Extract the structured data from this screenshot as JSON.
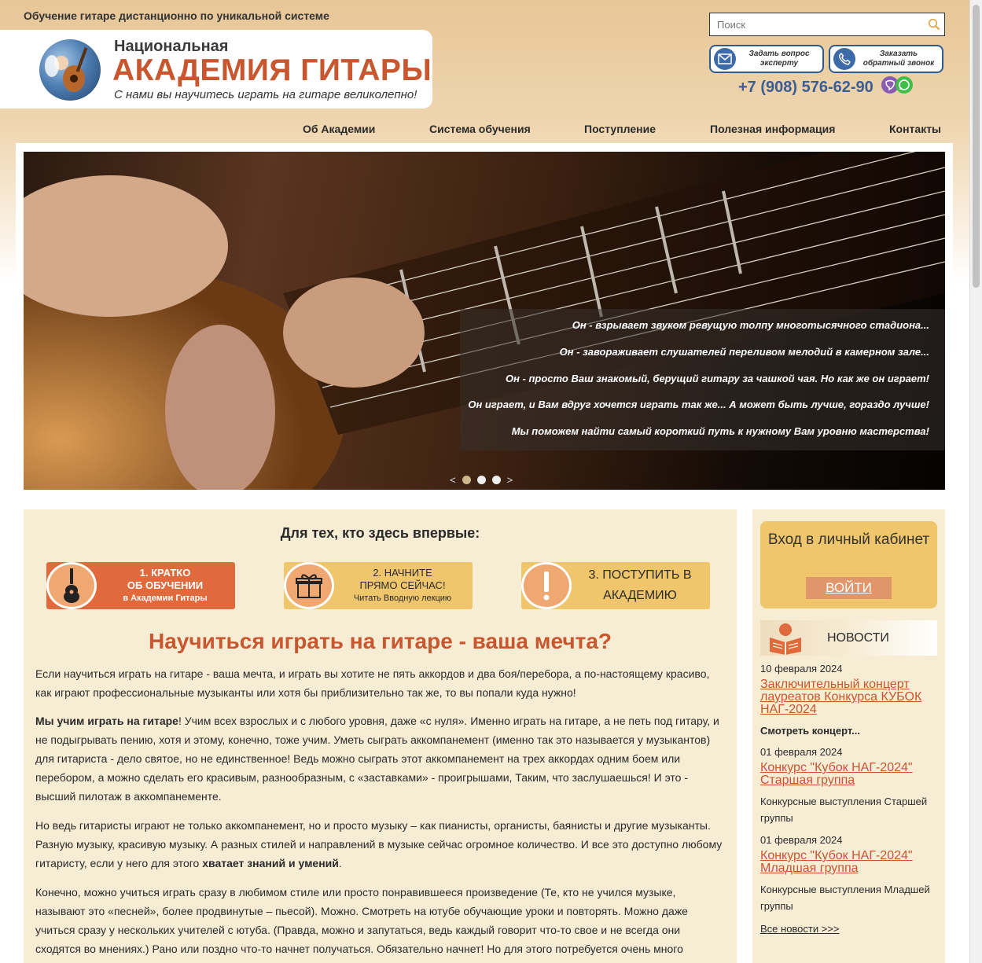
{
  "header": {
    "tagline": "Обучение гитаре дистанционно по уникальной системе",
    "logo_line1": "Национальная",
    "logo_line2": "АКАДЕМИЯ ГИТАРЫ",
    "logo_line3": "С нами вы научитесь играть на гитаре великолепно!",
    "search_placeholder": "Поиск",
    "ask_expert": "Задать вопрос\nэксперту",
    "callback": "Заказать\nобратный звонок",
    "phone": "+7 (908) 576-62-90"
  },
  "nav": {
    "items": [
      "Об Академии",
      "Система обучения",
      "Поступление",
      "Полезная информация",
      "Контакты"
    ]
  },
  "slider": {
    "lines": [
      "Он - взрывает звуком ревущую толпу многотысячного стадиона...",
      "Он - завораживает слушателей переливом мелодий в камерном зале...",
      "Он - просто Ваш знакомый, берущий гитару за чашкой чая. Но как же он играет!",
      "Он играет, и Вам вдруг хочется играть так же... А может быть лучше, гораздо лучше!",
      "Мы поможем найти самый короткий путь к нужному Вам уровню мастерства!"
    ],
    "prev": "<",
    "next": ">"
  },
  "main": {
    "welcome": "Для тех, кто здесь впервые:",
    "step1": {
      "a": "1. КРАТКО",
      "b": "ОБ ОБУЧЕНИИ",
      "c": "в Академии Гитары"
    },
    "step2": {
      "a": "2. НАЧНИТЕ",
      "b": "ПРЯМО СЕЙЧАС!",
      "c": "Читать Вводную лекцию"
    },
    "step3": {
      "a": "3. ПОСТУПИТЬ В",
      "b": "АКАДЕМИЮ"
    },
    "title": "Научиться играть на гитаре - ваша мечта?",
    "p1": "Если научиться играть на гитаре  - ваша мечта, и играть вы хотите  не пять аккордов и два боя/перебора, а по-настоящему красиво, как играют профессиональные музыканты или хотя бы приблизительно так же, то вы попали куда нужно!",
    "p2_bold": "Мы учим играть на гитаре",
    "p2": "! Учим всех взрослых и с любого уровня, даже «с нуля». Именно играть на гитаре, а не петь под гитару, и не подыгрывать пению, хотя и этому, конечно, тоже учим. Уметь сыграть аккомпанемент (именно так это называется у музыкантов) для гитариста - дело святое, но не единственное! Ведь можно сыграть этот аккомпанемент на трех аккордах одним боем или перебором, а можно сделать его красивым, разнообразным, с «заставками» - проигрышами, Таким, что заслушаешься! И это - высший пилотаж в аккомпанементе.",
    "p3": "Но ведь гитаристы играют не только аккомпанемент, но и просто музыку – как пианисты, органисты, баянисты и другие музыканты. Разную музыку, красивую музыку. А разных стилей и направлений в музыке сейчас огромное количество. И все это доступно любому гитаристу, если у него для этого ",
    "p3_bold": "хватает знаний и умений",
    "p3_end": ".",
    "p4": "Конечно, можно учиться играть сразу в любимом стиле или просто понравившееся произведение (Те, кто не учился музыке, называют это «песней», более продвинутые – пьесой). Можно. Смотреть на ютубе обучающие уроки и повторять. Можно даже учиться сразу у нескольких учителей с ютуба. (Правда, можно и запутаться, ведь каждый говорит что-то свое и не всегда они сходятся во мнениях.) Рано или поздно что-то начнет получаться. Обязательно начнет! Но для этого потребуется очень много времени. А вдруг за это время ваши"
  },
  "sidebar": {
    "login_title": "Вход в личный кабинет",
    "login_button": "ВОЙТИ",
    "news_title": "НОВОСТИ",
    "news": [
      {
        "date": "10 февраля 2024",
        "title": "Заключительный концерт лауреатов Конкурса КУБОК НАГ-2024",
        "desc": "Смотреть концерт..."
      },
      {
        "date": "01 февраля 2024",
        "title": "Конкурс \"Кубок НАГ-2024\" Старшая группа",
        "desc": "Конкурсные выступления Старшей группы"
      },
      {
        "date": "01 февраля 2024",
        "title": "Конкурс \"Кубок НАГ-2024\" Младшая группа",
        "desc": "Конкурсные выступления Младшей группы"
      }
    ],
    "all_news": "Все новости >>>"
  },
  "colors": {
    "accent": "#c8562f",
    "login_box": "#efc66b",
    "panel": "#f7ecd4",
    "phone": "#3a5d96"
  }
}
